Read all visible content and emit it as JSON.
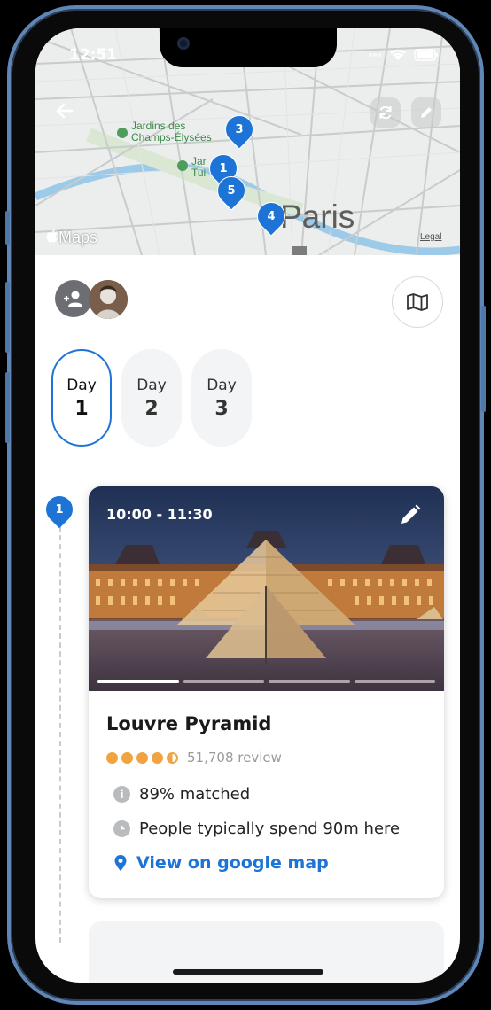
{
  "status": {
    "time": "12:51"
  },
  "map": {
    "labels": [
      "Jardins des",
      "Champs-Élysées",
      "Jar",
      "Tui"
    ],
    "city": "Paris",
    "provider": "Maps",
    "legal": "Legal",
    "pins": [
      "3",
      "1",
      "5",
      "4"
    ]
  },
  "days": [
    {
      "label": "Day",
      "num": "1"
    },
    {
      "label": "Day",
      "num": "2"
    },
    {
      "label": "Day",
      "num": "3"
    }
  ],
  "timeline": {
    "stop": "1"
  },
  "card": {
    "time_range": "10:00 - 11:30",
    "name": "Louvre Pyramid",
    "rating": 4.5,
    "reviews": "51,708 review",
    "matched": "89% matched",
    "spend": "People typically spend 90m here",
    "map_link": "View on google map",
    "photo_pages": 4,
    "photo_index": 1
  },
  "colors": {
    "accent": "#1e74d6",
    "star": "#f2a341"
  }
}
